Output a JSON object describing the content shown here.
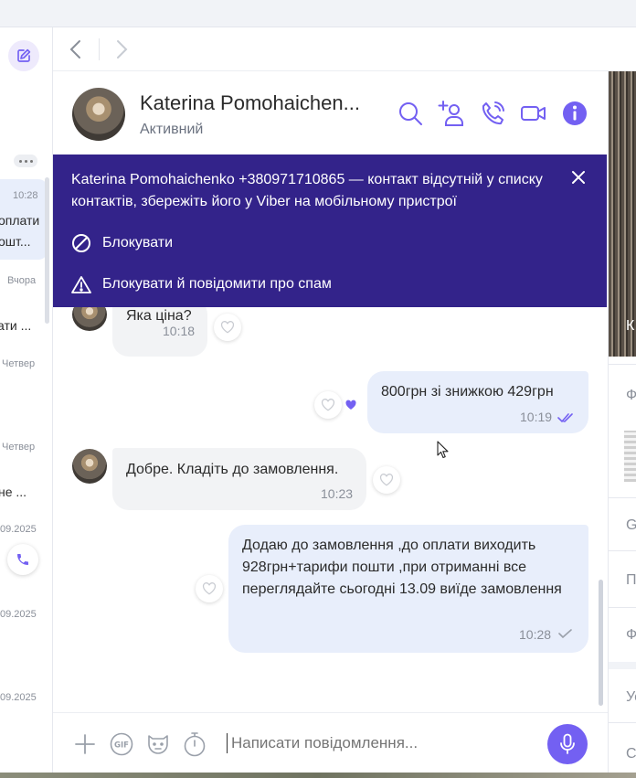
{
  "chat_list": {
    "items": [
      {
        "time": "10:28",
        "preview_line1": "оплати",
        "preview_line2": "ошт..."
      },
      {
        "time": "Вчора",
        "preview": "ати ..."
      },
      {
        "time": "Четвер",
        "preview": ""
      },
      {
        "time": "Четвер",
        "preview": "не ..."
      },
      {
        "time": "09.2025",
        "preview": ""
      },
      {
        "time": "09.2025",
        "preview": ""
      },
      {
        "time": "09.2025",
        "preview": ""
      }
    ]
  },
  "header": {
    "contact_name": "Katerina Pomohaichen...",
    "status": "Активний"
  },
  "banner": {
    "message": "Katerina Pomohaichenko +380971710865 — контакт відсутній у списку контактів, збережіть його у Viber на мобільному пристрої",
    "block_label": "Блокувати",
    "block_report_label": "Блокувати й повідомити про спам"
  },
  "messages": [
    {
      "direction": "in",
      "text": "Яка ціна?",
      "time": "10:18"
    },
    {
      "direction": "out",
      "text": "800грн зі знижкою 429грн",
      "time": "10:19",
      "status": "read"
    },
    {
      "direction": "in",
      "text": "Добре. Кладіть до замовлення.",
      "time": "10:23"
    },
    {
      "direction": "out",
      "text": "Додаю до замовлення ,до оплати виходить 928грн+тарифи пошти ,при отриманні все переглядайте сьогодні 13.09 виїде замовлення",
      "time": "10:28",
      "status": "delivered"
    }
  ],
  "composer": {
    "placeholder": "Написати повідомлення..."
  },
  "info_panel": {
    "labels": [
      "К",
      "Ф",
      "G",
      "П",
      "Ф",
      "Ус",
      "С"
    ]
  },
  "colors": {
    "accent": "#7360f2",
    "banner_bg": "#33238a",
    "outgoing_bubble": "#e8eefb",
    "incoming_bubble": "#f2f3f5"
  }
}
